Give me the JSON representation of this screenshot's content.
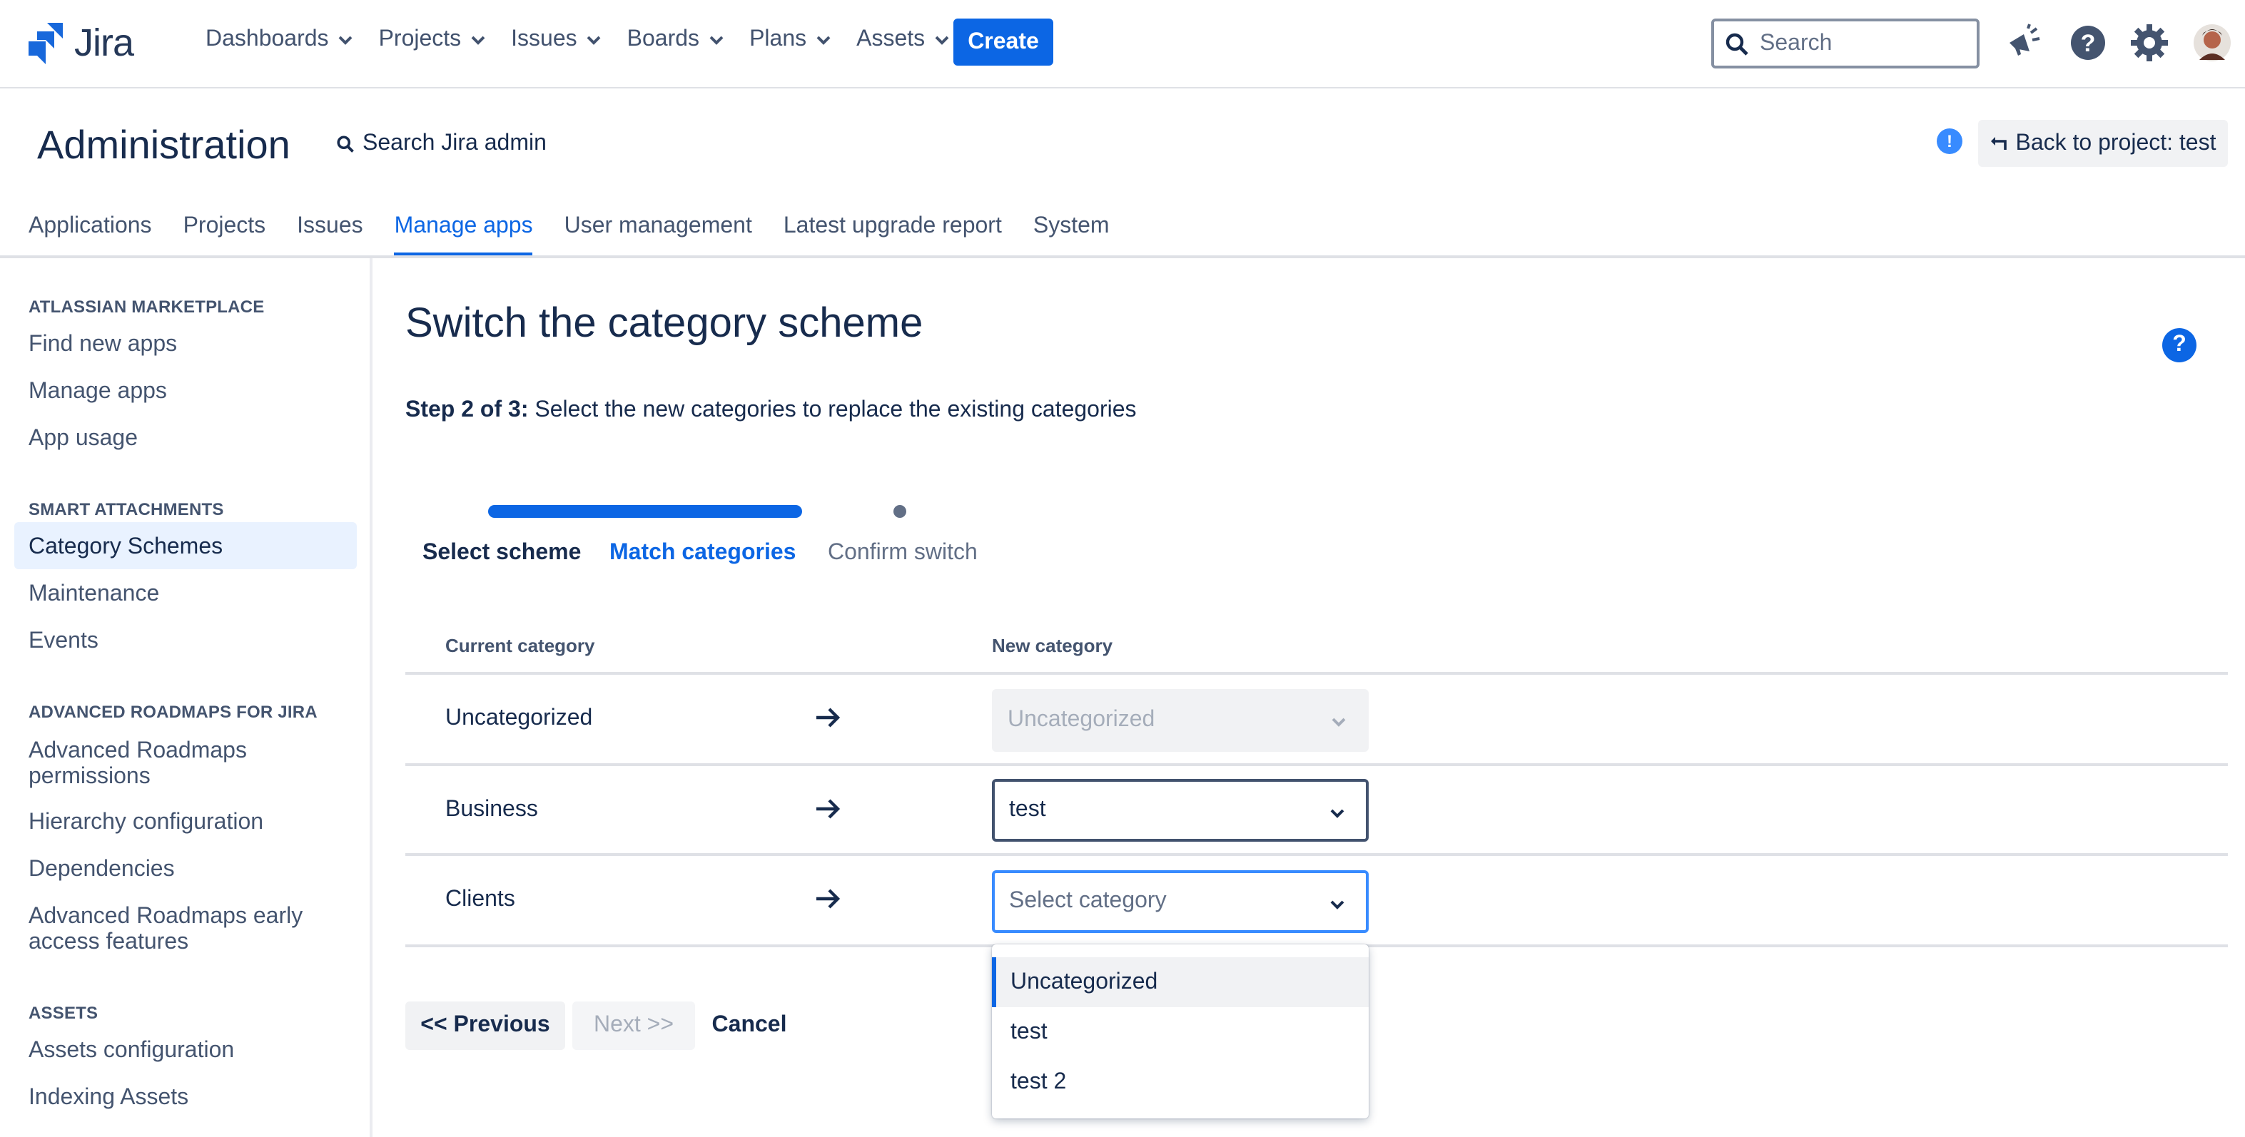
{
  "app": {
    "name": "Jira"
  },
  "nav": {
    "items": [
      "Dashboards",
      "Projects",
      "Issues",
      "Boards",
      "Plans",
      "Assets"
    ],
    "create_label": "Create",
    "search_placeholder": "Search"
  },
  "admin": {
    "title": "Administration",
    "search_label": "Search Jira admin",
    "back_label": "Back to project: test",
    "tabs": [
      "Applications",
      "Projects",
      "Issues",
      "Manage apps",
      "User management",
      "Latest upgrade report",
      "System"
    ],
    "active_tab": "Manage apps"
  },
  "sidebar": {
    "sections": [
      {
        "heading": "ATLASSIAN MARKETPLACE",
        "items": [
          "Find new apps",
          "Manage apps",
          "App usage"
        ]
      },
      {
        "heading": "SMART ATTACHMENTS",
        "items": [
          "Category Schemes",
          "Maintenance",
          "Events"
        ]
      },
      {
        "heading": "ADVANCED ROADMAPS FOR JIRA",
        "items": [
          "Advanced Roadmaps permissions",
          "Hierarchy configuration",
          "Dependencies",
          "Advanced Roadmaps early access features"
        ]
      },
      {
        "heading": "ASSETS",
        "items": [
          "Assets configuration",
          "Indexing Assets"
        ]
      }
    ],
    "active_item": "Category Schemes"
  },
  "main": {
    "title": "Switch the category scheme",
    "step_prefix": "Step 2 of 3:",
    "step_text": " Select the new categories to replace the existing categories",
    "stepper": [
      "Select scheme",
      "Match categories",
      "Confirm switch"
    ],
    "columns": {
      "current": "Current category",
      "new": "New category"
    },
    "rows": [
      {
        "current": "Uncategorized",
        "new": "Uncategorized",
        "state": "disabled"
      },
      {
        "current": "Business",
        "new": "test",
        "state": "selected"
      },
      {
        "current": "Clients",
        "new": "Select category",
        "state": "open"
      }
    ],
    "dropdown_options": [
      "Uncategorized",
      "test",
      "test 2"
    ],
    "dropdown_highlighted": "Uncategorized",
    "buttons": {
      "previous": "<< Previous",
      "next": "Next >>",
      "cancel": "Cancel"
    }
  },
  "colors": {
    "primary": "#0c66e4",
    "text": "#172b4d",
    "subtle": "#44546f",
    "active_bg": "#e9f2ff"
  }
}
